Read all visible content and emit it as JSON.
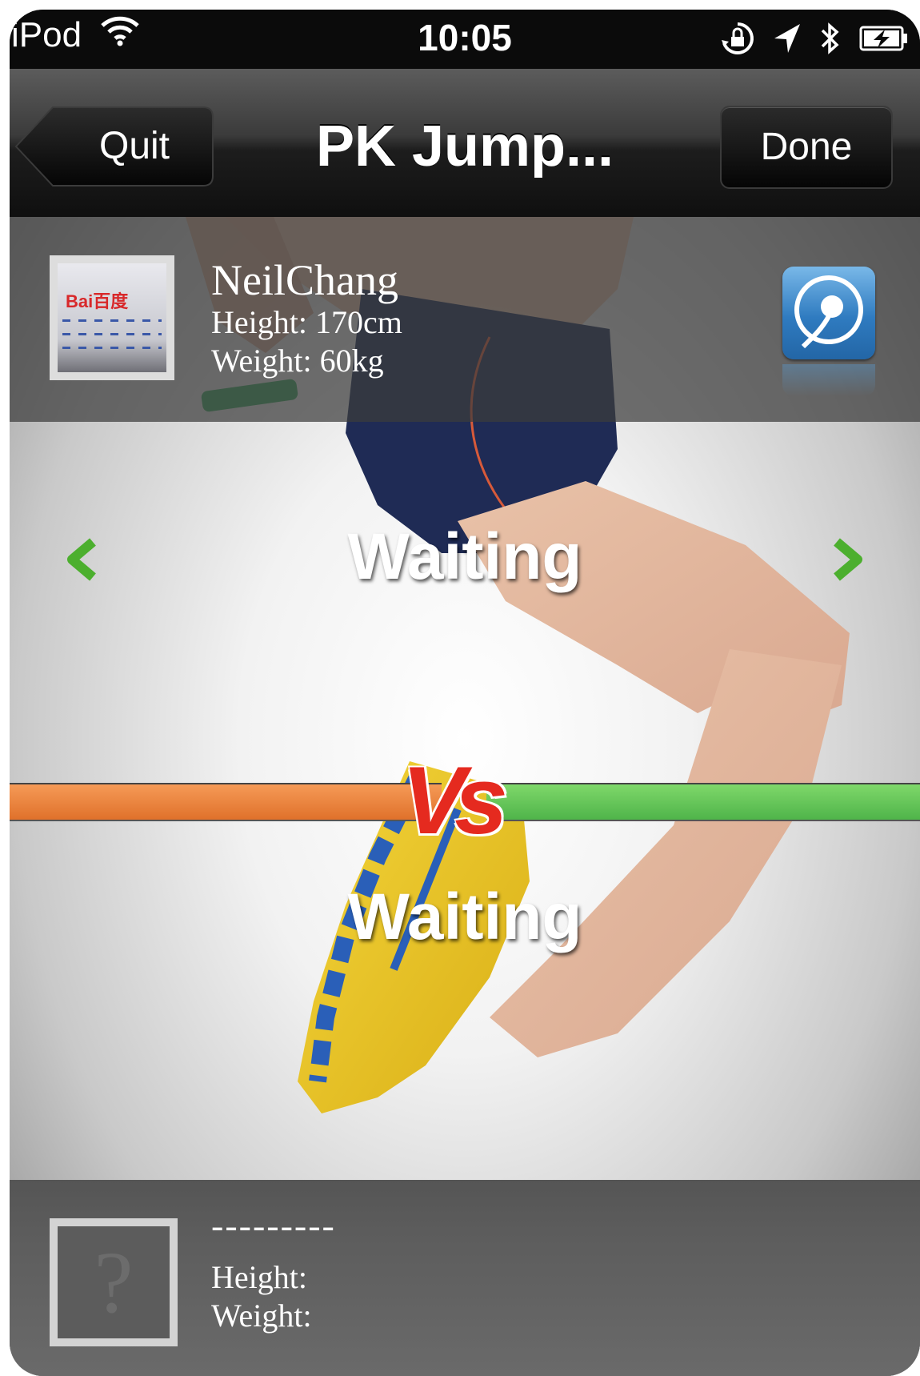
{
  "status_bar": {
    "carrier": "iPod",
    "time": "10:05",
    "icons": [
      "wifi-icon",
      "orientation-lock-icon",
      "location-arrow-icon",
      "bluetooth-icon",
      "battery-charging-icon"
    ]
  },
  "nav": {
    "title": "PK Jump...",
    "back_label": "Quit",
    "done_label": "Done"
  },
  "player1": {
    "name": "NeilChang",
    "height": "Height: 170cm",
    "weight": "Weight: 60kg",
    "avatar_logo": "Bai百度"
  },
  "player1_status": "Waiting",
  "versus_label": "Vs",
  "player2_status": "Waiting",
  "player2": {
    "name": "---------",
    "height": "Height:",
    "weight": "Weight:",
    "avatar_placeholder": "?"
  },
  "colors": {
    "player1_bar": "#e0712b",
    "player2_bar": "#4fb44a",
    "vs": "#e52a1f",
    "arrows": "#4caf2e",
    "device_button": "#2f7bc0"
  }
}
